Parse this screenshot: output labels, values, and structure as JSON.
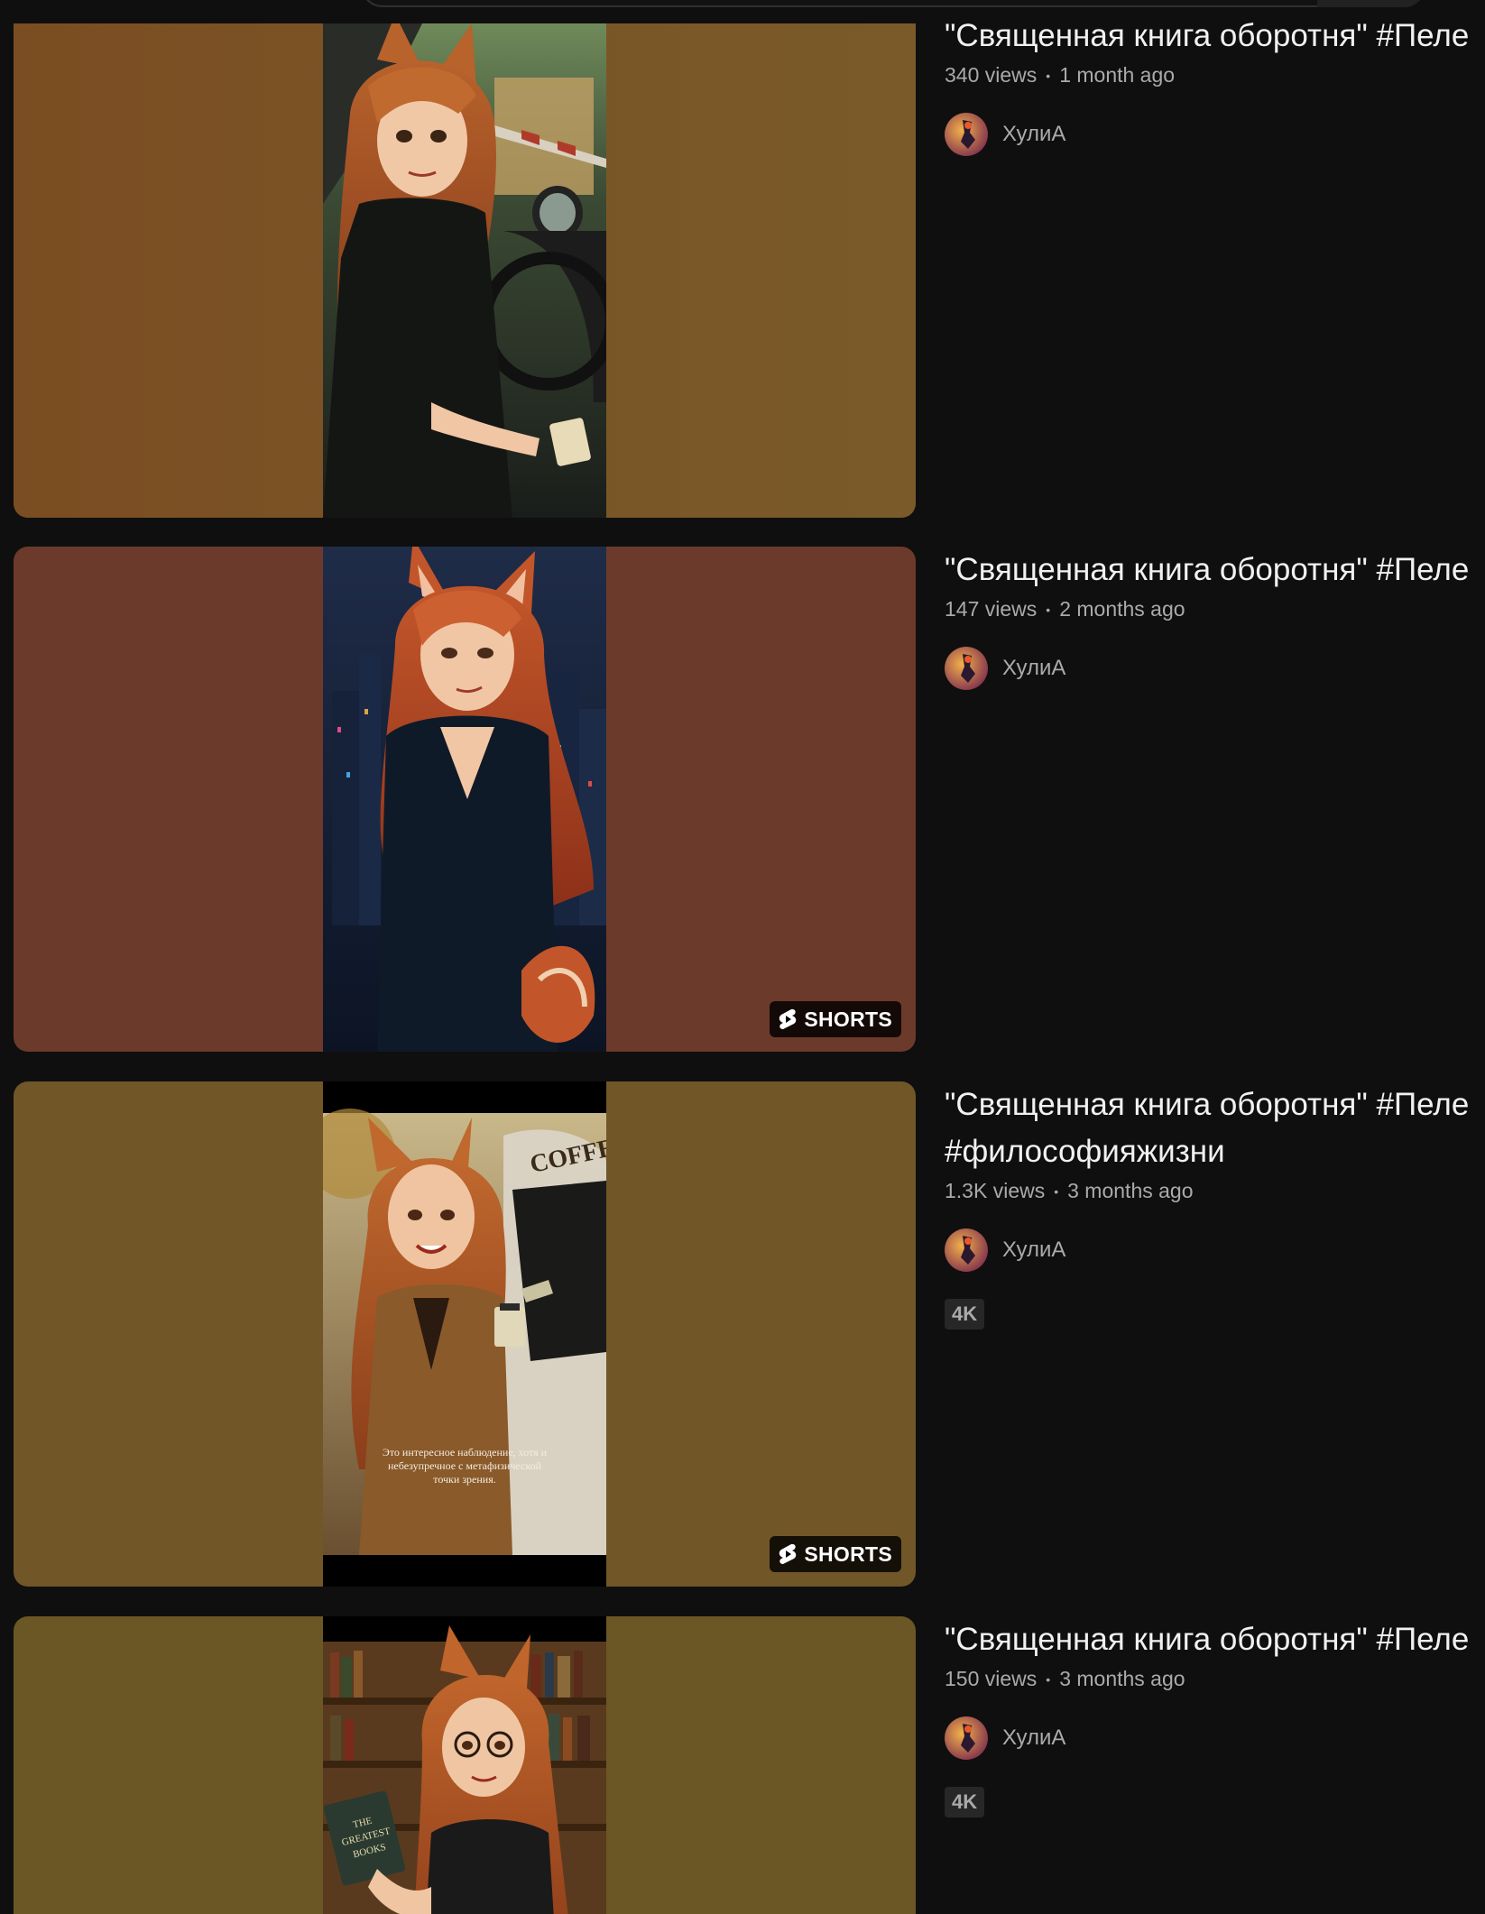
{
  "videos": [
    {
      "title": "\"Священная книга оборотня\" #Пеле",
      "title_line2": "",
      "views": "340 views",
      "age": "1 month ago",
      "channel": "ХулиА",
      "shorts_label": "",
      "quality_badge": "",
      "bg_color": "#7a5526"
    },
    {
      "title": "\"Священная книга оборотня\" #Пеле",
      "title_line2": "",
      "views": "147 views",
      "age": "2 months ago",
      "channel": "ХулиА",
      "shorts_label": "SHORTS",
      "quality_badge": "",
      "bg_color": "#6c3a2b"
    },
    {
      "title": "\"Священная книга оборотня\" #Пеле",
      "title_line2": "#философияжизни",
      "views": "1.3K views",
      "age": "3 months ago",
      "channel": "ХулиА",
      "shorts_label": "SHORTS",
      "quality_badge": "4K",
      "bg_color": "#715628",
      "subtitle_text": "Это интересное наблюдение, хотя и небезупречное с метафизической точки зрения.",
      "sign_text": "COFFEE"
    },
    {
      "title": "\"Священная книга оборотня\" #Пеле",
      "title_line2": "",
      "views": "150 views",
      "age": "3 months ago",
      "channel": "ХулиА",
      "shorts_label": "",
      "quality_badge": "4K",
      "bg_color": "#6b5726",
      "book_text": "THE GREATEST BOOKS"
    }
  ],
  "icons": {
    "shorts": "shorts-logo-icon",
    "avatar": "channel-avatar"
  }
}
